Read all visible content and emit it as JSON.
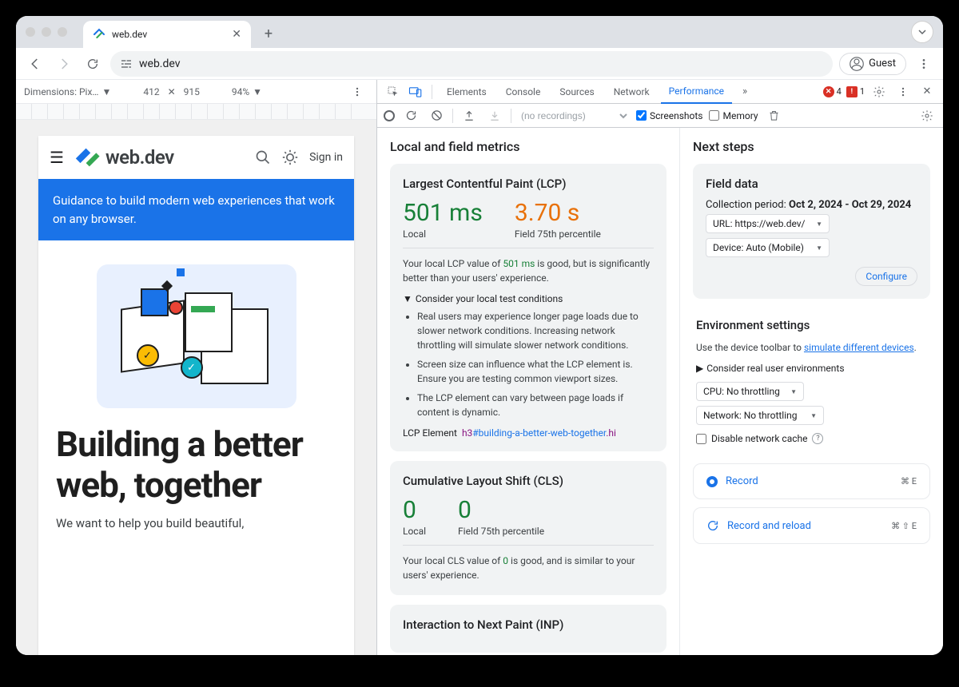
{
  "browser": {
    "tab_title": "web.dev",
    "url": "web.dev",
    "guest_label": "Guest"
  },
  "device_toolbar": {
    "dimensions_label": "Dimensions: Pix…",
    "width": "412",
    "height": "915",
    "zoom": "94%"
  },
  "devtools_tabs": {
    "elements": "Elements",
    "console": "Console",
    "sources": "Sources",
    "network": "Network",
    "performance": "Performance",
    "errors": "4",
    "issues": "1"
  },
  "perf_toolbar": {
    "recordings_placeholder": "(no recordings)",
    "screenshots_label": "Screenshots",
    "memory_label": "Memory"
  },
  "metrics": {
    "section_title": "Local and field metrics",
    "lcp": {
      "title": "Largest Contentful Paint (LCP)",
      "local_value": "501 ms",
      "local_label": "Local",
      "field_value": "3.70 s",
      "field_label": "Field 75th percentile",
      "desc_pre": "Your local LCP value of ",
      "desc_val": "501 ms",
      "desc_post": " is good, but is significantly better than your users' experience.",
      "disclosure": "Consider your local test conditions",
      "bullet1": "Real users may experience longer page loads due to slower network conditions. Increasing network throttling will simulate slower network conditions.",
      "bullet2": "Screen size can influence what the LCP element is. Ensure you are testing common viewport sizes.",
      "bullet3": "The LCP element can vary between page loads if content is dynamic.",
      "el_label": "LCP Element",
      "el_tag": "h3",
      "el_id": "#building-a-better-web-together",
      "el_cls": ".hi"
    },
    "cls": {
      "title": "Cumulative Layout Shift (CLS)",
      "local_value": "0",
      "local_label": "Local",
      "field_value": "0",
      "field_label": "Field 75th percentile",
      "desc_pre": "Your local CLS value of ",
      "desc_val": "0",
      "desc_post": " is good, and is similar to your users' experience."
    },
    "inp": {
      "title": "Interaction to Next Paint (INP)"
    }
  },
  "next_steps": {
    "section_title": "Next steps",
    "field_data": {
      "title": "Field data",
      "period_label": "Collection period: ",
      "period_value": "Oct 2, 2024 - Oct 29, 2024",
      "url_select": "URL: https://web.dev/",
      "device_select": "Device: Auto (Mobile)",
      "configure": "Configure"
    },
    "env": {
      "title": "Environment settings",
      "text_pre": "Use the device toolbar to ",
      "link": "simulate different devices",
      "disclosure": "Consider real user environments",
      "cpu_select": "CPU: No throttling",
      "net_select": "Network: No throttling",
      "cache_label": "Disable network cache"
    },
    "record": {
      "label": "Record",
      "shortcut": "⌘ E"
    },
    "record_reload": {
      "label": "Record and reload",
      "shortcut": "⌘ ⇧ E"
    }
  },
  "site_preview": {
    "logo_text": "web.dev",
    "sign_in": "Sign in",
    "banner": "Guidance to build modern web experiences that work on any browser.",
    "hero_title": "Building a better web, together",
    "hero_sub": "We want to help you build beautiful,"
  }
}
